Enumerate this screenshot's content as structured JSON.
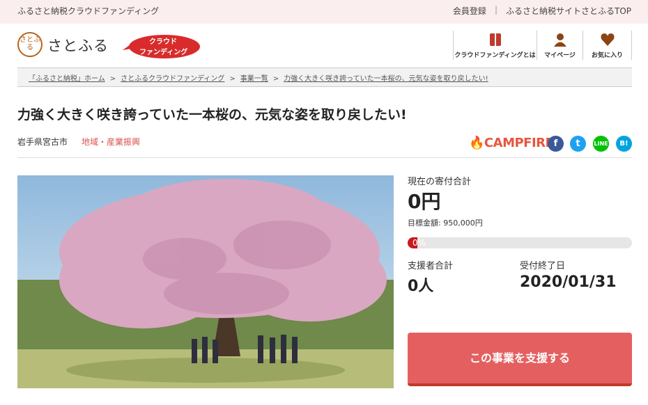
{
  "topbar": {
    "site_title": "ふるさと納税クラウドファンディング",
    "register": "会員登録",
    "sep": "|",
    "satofull_top": "ふるさと納税サイトさとふるTOP"
  },
  "header": {
    "logo_mark": "さとふる",
    "logo_text": "さとふる",
    "badge_line1": "クラウド",
    "badge_line2": "ファンディング",
    "nav": [
      {
        "label": "クラウドファンディングとは",
        "icon": "book-icon"
      },
      {
        "label": "マイページ",
        "icon": "person-icon"
      },
      {
        "label": "お気に入り",
        "icon": "heart-icon"
      }
    ],
    "brand_color": "#c0392b"
  },
  "breadcrumb": {
    "items": [
      "「ふるさと納税」ホーム",
      "さとふるクラウドファンディング",
      "事業一覧",
      "力強く大きく咲き誇っていた一本桜の、元気な姿を取り戻したい!"
    ],
    "sep": ">"
  },
  "project": {
    "title": "力強く大きく咲き誇っていた一本桜の、元気な姿を取り戻したい!",
    "location": "岩手県宮古市",
    "category": "地域・産業振興",
    "partner": "CAMPFIRE",
    "share": [
      {
        "name": "facebook",
        "glyph": "f"
      },
      {
        "name": "twitter",
        "glyph": "t"
      },
      {
        "name": "line",
        "glyph": "LINE"
      },
      {
        "name": "hatena",
        "glyph": "B!"
      }
    ]
  },
  "stats": {
    "total_label": "現在の寄付合計",
    "total_value": "0円",
    "target_text": "目標金額: 950,000円",
    "progress_percent": 0,
    "progress_text": "0%",
    "supporters_label": "支援者合計",
    "supporters_value": "0人",
    "deadline_label": "受付終了日",
    "deadline_value": "2020/01/31"
  },
  "cta": {
    "support_label": "この事業を支援する"
  }
}
